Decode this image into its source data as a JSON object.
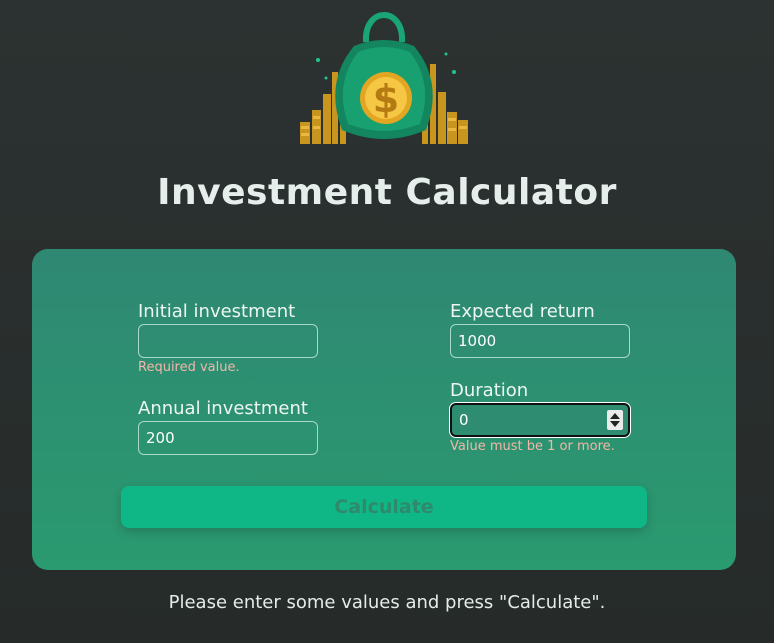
{
  "app": {
    "title": "Investment Calculator",
    "logo_icon": "money-bag-dollar-icon"
  },
  "form": {
    "initial_investment": {
      "label": "Initial investment",
      "value": "",
      "error": "Required value."
    },
    "annual_investment": {
      "label": "Annual investment",
      "value": "200"
    },
    "expected_return": {
      "label": "Expected return",
      "value": "1000"
    },
    "duration": {
      "label": "Duration",
      "value": "0",
      "error": "Value must be 1 or more."
    },
    "calculate_label": "Calculate"
  },
  "footer": {
    "message": "Please enter some values and press \"Calculate\"."
  },
  "colors": {
    "background": "#292e2d",
    "card": "#2e8f71",
    "button": "#10b786",
    "error": "#f2b6a9"
  }
}
